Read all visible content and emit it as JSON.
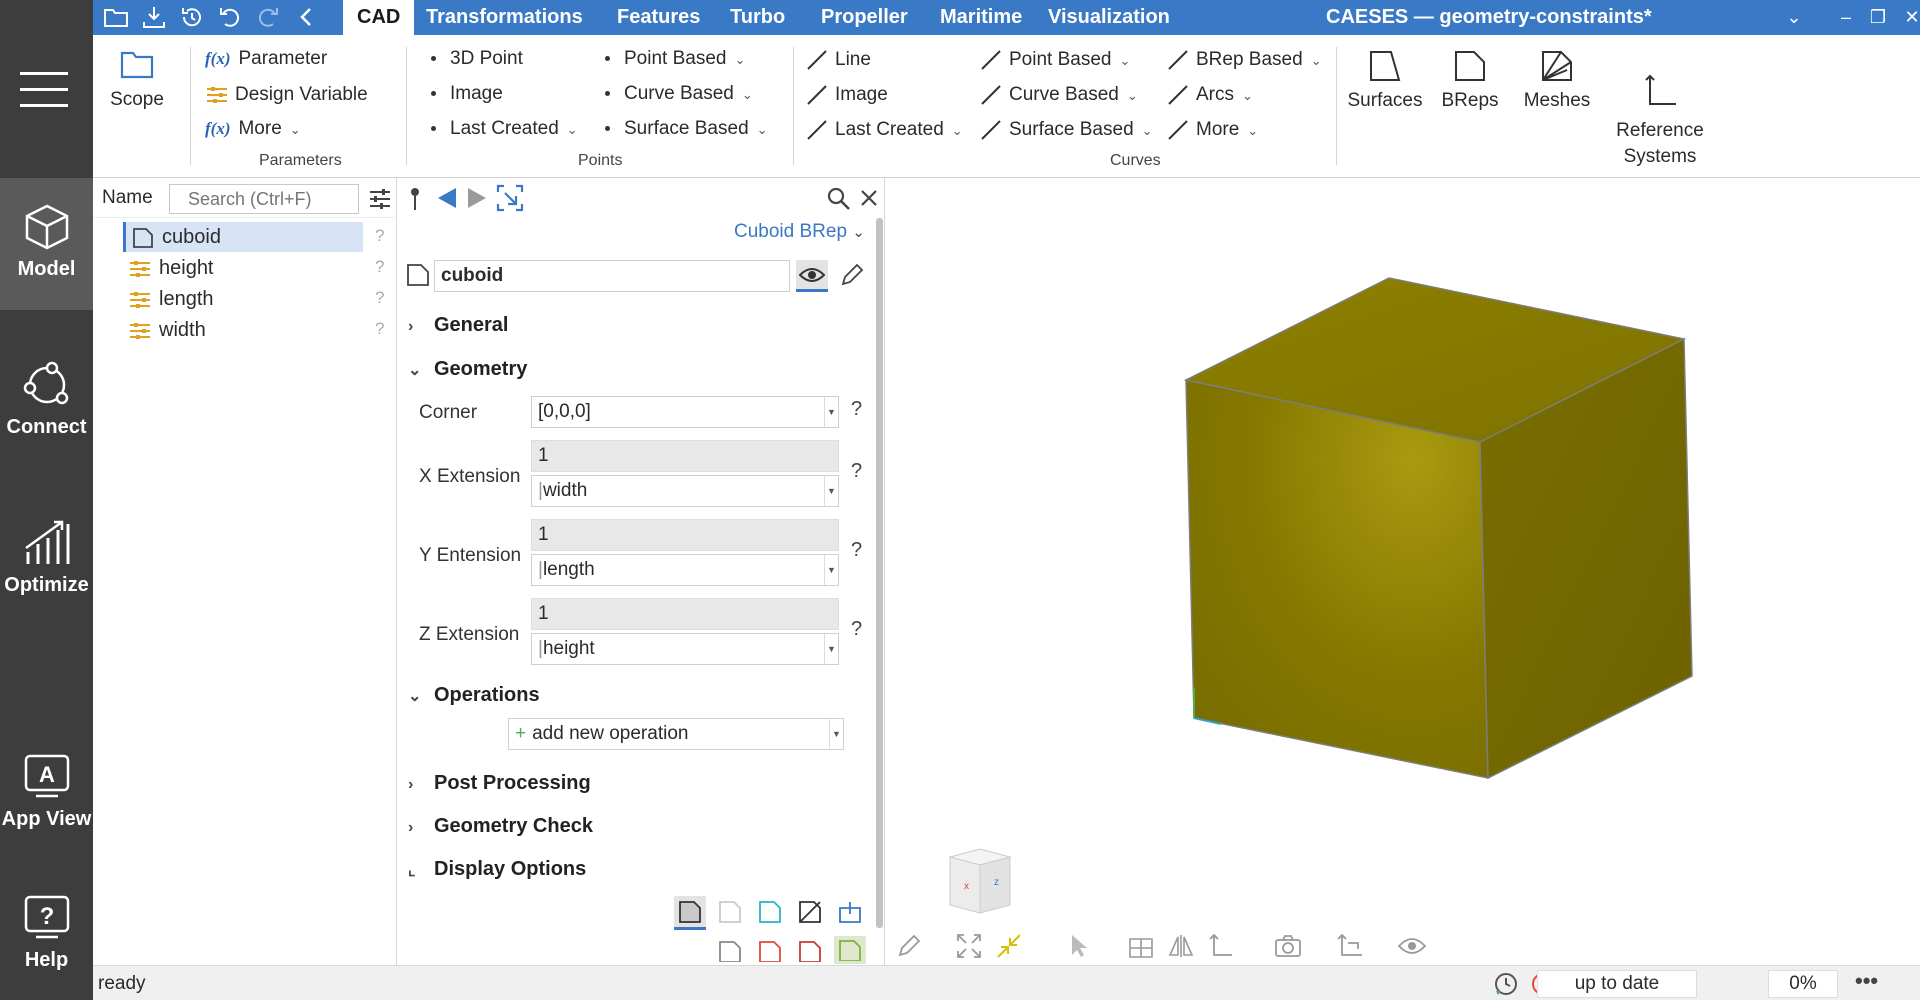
{
  "window": {
    "title": "CAESES — geometry-constraints*",
    "tabs": [
      "CAD",
      "Transformations",
      "Features",
      "Turbo",
      "Propeller",
      "Maritime",
      "Visualization"
    ],
    "active_tab": "CAD"
  },
  "nav": {
    "items": [
      {
        "label": "Model",
        "icon": "cube-icon"
      },
      {
        "label": "Connect",
        "icon": "connect-icon"
      },
      {
        "label": "Optimize",
        "icon": "optimize-icon"
      },
      {
        "label": "App View",
        "icon": "app-view-icon"
      },
      {
        "label": "Help",
        "icon": "help-icon"
      }
    ],
    "active": "Model"
  },
  "ribbon": {
    "scope": "Scope",
    "parameters": {
      "group": "Parameters",
      "items": [
        "Parameter",
        "Design Variable",
        "More"
      ]
    },
    "points": {
      "group": "Points",
      "col1": [
        "3D Point",
        "Image",
        "Last Created"
      ],
      "col2": [
        "Point Based",
        "Curve Based",
        "Surface Based"
      ]
    },
    "curves": {
      "group": "Curves",
      "col1": [
        "Line",
        "Image",
        "Last Created"
      ],
      "col2": [
        "Point Based",
        "Curve Based",
        "Surface Based"
      ],
      "col3": [
        "BRep Based",
        "Arcs",
        "More"
      ]
    },
    "big": [
      "Surfaces",
      "BReps",
      "Meshes",
      "Reference\nSystems"
    ]
  },
  "tree": {
    "name_label": "Name",
    "search_placeholder": "Search (Ctrl+F)",
    "rows": [
      {
        "label": "cuboid",
        "icon": "brep-icon",
        "selected": true
      },
      {
        "label": "height",
        "icon": "parameter-icon"
      },
      {
        "label": "length",
        "icon": "parameter-icon"
      },
      {
        "label": "width",
        "icon": "parameter-icon"
      }
    ],
    "qmark": "?"
  },
  "props": {
    "type_label": "Cuboid BRep",
    "object_name": "cuboid",
    "sections": {
      "general": "General",
      "geometry": "Geometry",
      "operations": "Operations",
      "post_processing": "Post Processing",
      "geometry_check": "Geometry Check",
      "display_options": "Display Options"
    },
    "corner": {
      "label": "Corner",
      "value": "[0,0,0]"
    },
    "x_ext": {
      "label": "X Extension",
      "computed": "1",
      "expr": "width"
    },
    "y_ext": {
      "label": "Y Entension",
      "computed": "1",
      "expr": "length"
    },
    "z_ext": {
      "label": "Z Extension",
      "computed": "1",
      "expr": "height"
    },
    "add_operation": "add new operation",
    "qmark": "?"
  },
  "viewport": {
    "object_color": "#8a7a00"
  },
  "status": {
    "text": "ready",
    "state": "up to date",
    "progress": "0%"
  }
}
